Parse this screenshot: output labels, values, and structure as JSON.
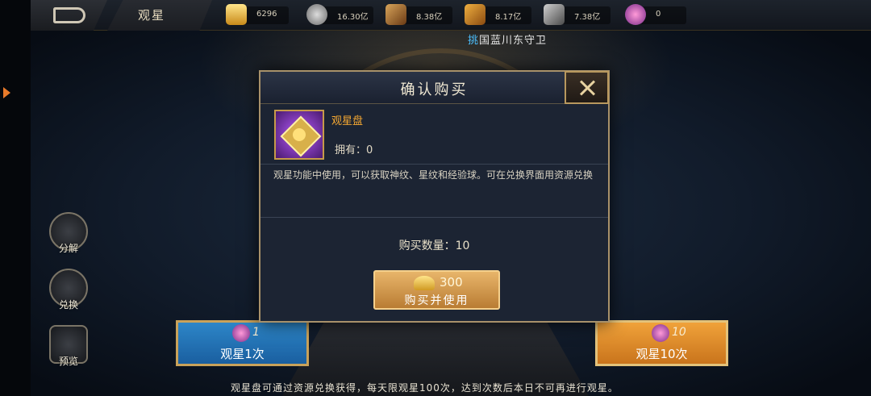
{
  "topbar": {
    "title": "观星",
    "resources": [
      {
        "name": "gold-ingot",
        "value": "6296",
        "color": "#e8b53a"
      },
      {
        "name": "silver-coin",
        "value": "16.30亿",
        "color": "#a8a8a8"
      },
      {
        "name": "scroll",
        "value": "8.38亿",
        "color": "#b8863a"
      },
      {
        "name": "token",
        "value": "8.17亿",
        "color": "#c88a2a"
      },
      {
        "name": "iron",
        "value": "7.38亿",
        "color": "#8a8a8a"
      },
      {
        "name": "star-gem",
        "value": "0",
        "color": "#c85ab0"
      }
    ]
  },
  "marquee": {
    "highlight": "挑",
    "text": "国蓝川东守卫"
  },
  "sidebar": {
    "items": [
      {
        "label": "分解",
        "icon": "decompose-icon"
      },
      {
        "label": "兑换",
        "icon": "exchange-icon"
      },
      {
        "label": "预览",
        "icon": "preview-icon"
      }
    ]
  },
  "actions": {
    "once": {
      "count": "1",
      "label": "观星1次"
    },
    "ten": {
      "count": "10",
      "label": "观星10次"
    }
  },
  "hint": "观星盘可通过资源兑换获得，每天限观星100次，达到次数后本日不可再进行观星。",
  "modal": {
    "title": "确认购买",
    "item_name": "观星盘",
    "owned": "拥有：0",
    "description": "观星功能中使用，可以获取神纹、星纹和经验球。可在兑换界面用资源兑换",
    "quantity": "购买数量：10",
    "price": "300",
    "buy_label": "购买并使用"
  }
}
